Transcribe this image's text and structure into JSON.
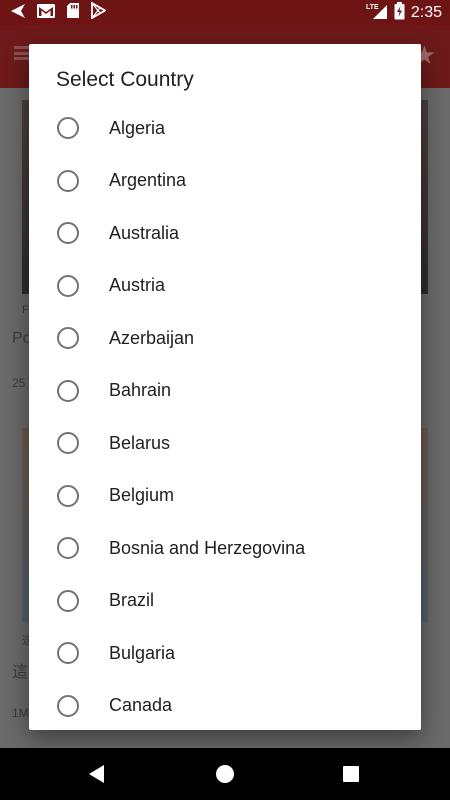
{
  "status_bar": {
    "time": "2:35",
    "network": "LTE",
    "icons": [
      "navigation-arrow-icon",
      "gmail-icon",
      "sd-card-icon",
      "play-store-icon",
      "signal-icon",
      "battery-charging-icon"
    ]
  },
  "dialog": {
    "title": "Select Country",
    "countries": [
      "Algeria",
      "Argentina",
      "Australia",
      "Austria",
      "Azerbaijan",
      "Bahrain",
      "Belarus",
      "Belgium",
      "Bosnia and Herzegovina",
      "Brazil",
      "Bulgaria",
      "Canada"
    ],
    "selected": null
  },
  "background": {
    "text_fragments": [
      "F",
      "Po",
      "25",
      "这",
      "這",
      "1M"
    ]
  },
  "colors": {
    "status_bar": "#6f1414",
    "app_bar": "#6e1a1a",
    "radio_border": "#737373",
    "text_primary": "#212121"
  }
}
